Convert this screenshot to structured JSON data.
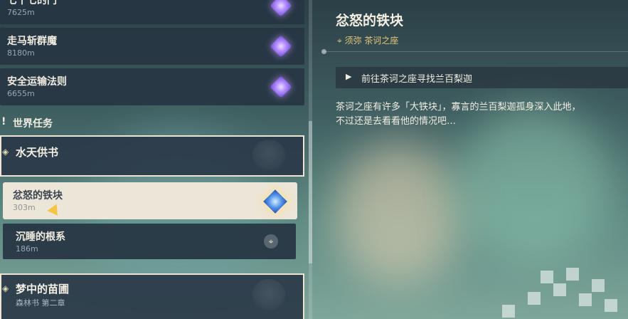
{
  "quests": [
    {
      "title": "七十七的门",
      "distance": "7625m"
    },
    {
      "title": "走马斩群魔",
      "distance": "8180m"
    },
    {
      "title": "安全运输法则",
      "distance": "6655m"
    }
  ],
  "category": {
    "label": "世界任务",
    "icon": "exclamation-icon"
  },
  "groups": [
    {
      "title": "水天供书",
      "subtitle": ""
    },
    {
      "title": "梦中的苗圃",
      "subtitle": "森林书 第二章"
    }
  ],
  "selected_quest": {
    "title": "忿怒的铁块",
    "distance": "303m"
  },
  "sub_quest": {
    "title": "沉睡的根系",
    "distance": "186m"
  },
  "detail": {
    "title": "忿怒的铁块",
    "location": "须弥 茶诃之座",
    "objective": "前往茶诃之座寻找兰百梨迦",
    "description_lines": [
      "茶诃之座有许多「大铁块」，寡言的兰百梨迦孤身深入此地，",
      "不过还是去看看他的情况吧…"
    ]
  },
  "colors": {
    "panel": "#263442",
    "accent_gold": "#e5c67a",
    "selected": "#ece6d8",
    "purple_marker": "#b48cff"
  }
}
